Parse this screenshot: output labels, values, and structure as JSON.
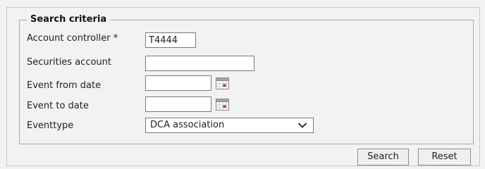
{
  "search_criteria": {
    "legend": "Search criteria",
    "fields": {
      "account_controller": {
        "label": "Account controller *",
        "value": "T4444"
      },
      "securities_account": {
        "label": "Securities account",
        "value": ""
      },
      "event_from_date": {
        "label": "Event from date",
        "value": "",
        "icon": "calendar-icon"
      },
      "event_to_date": {
        "label": "Event to date",
        "value": "",
        "icon": "calendar-icon"
      },
      "eventtype": {
        "label": "Eventtype",
        "selected": "DCA association",
        "icon": "chevron-down-icon"
      }
    }
  },
  "buttons": {
    "search": "Search",
    "reset": "Reset"
  },
  "colors": {
    "background": "#f2f2f2",
    "border": "#a9a9a9",
    "input_border": "#7a7a7a",
    "calendar_accent": "#c0392b"
  }
}
